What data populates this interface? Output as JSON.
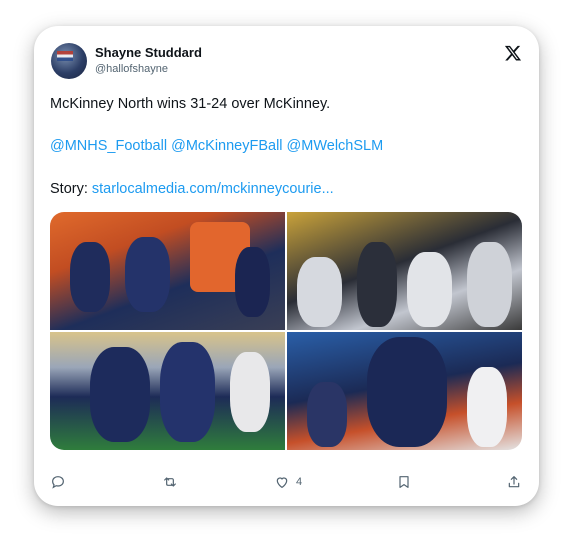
{
  "author": {
    "name": "Shayne Studdard",
    "handle": "@hallofshayne"
  },
  "tweet": {
    "line1": "McKinney North wins 31-24 over McKinney.",
    "mentions": [
      "@MNHS_Football",
      "@McKinneyFBall",
      "@MWelchSLM"
    ],
    "story_label": "Story: ",
    "story_link": "starlocalmedia.com/mckinneycourie..."
  },
  "media": [
    {
      "alt": "Players in navy jerseys with orange flags running onto field"
    },
    {
      "alt": "Players in white jerseys with gold helmets on sideline"
    },
    {
      "alt": "Player in navy jersey number 0 blocking on field"
    },
    {
      "alt": "Player in navy Dawgs jersey number 11 running with ball"
    }
  ],
  "actions": {
    "reply_icon": "reply-icon",
    "retweet_icon": "retweet-icon",
    "like_icon": "heart-icon",
    "like_count": "4",
    "bookmark_icon": "bookmark-icon",
    "share_icon": "share-icon"
  },
  "colors": {
    "link": "#1d9bf0",
    "text": "#0f1419",
    "muted": "#536471"
  }
}
